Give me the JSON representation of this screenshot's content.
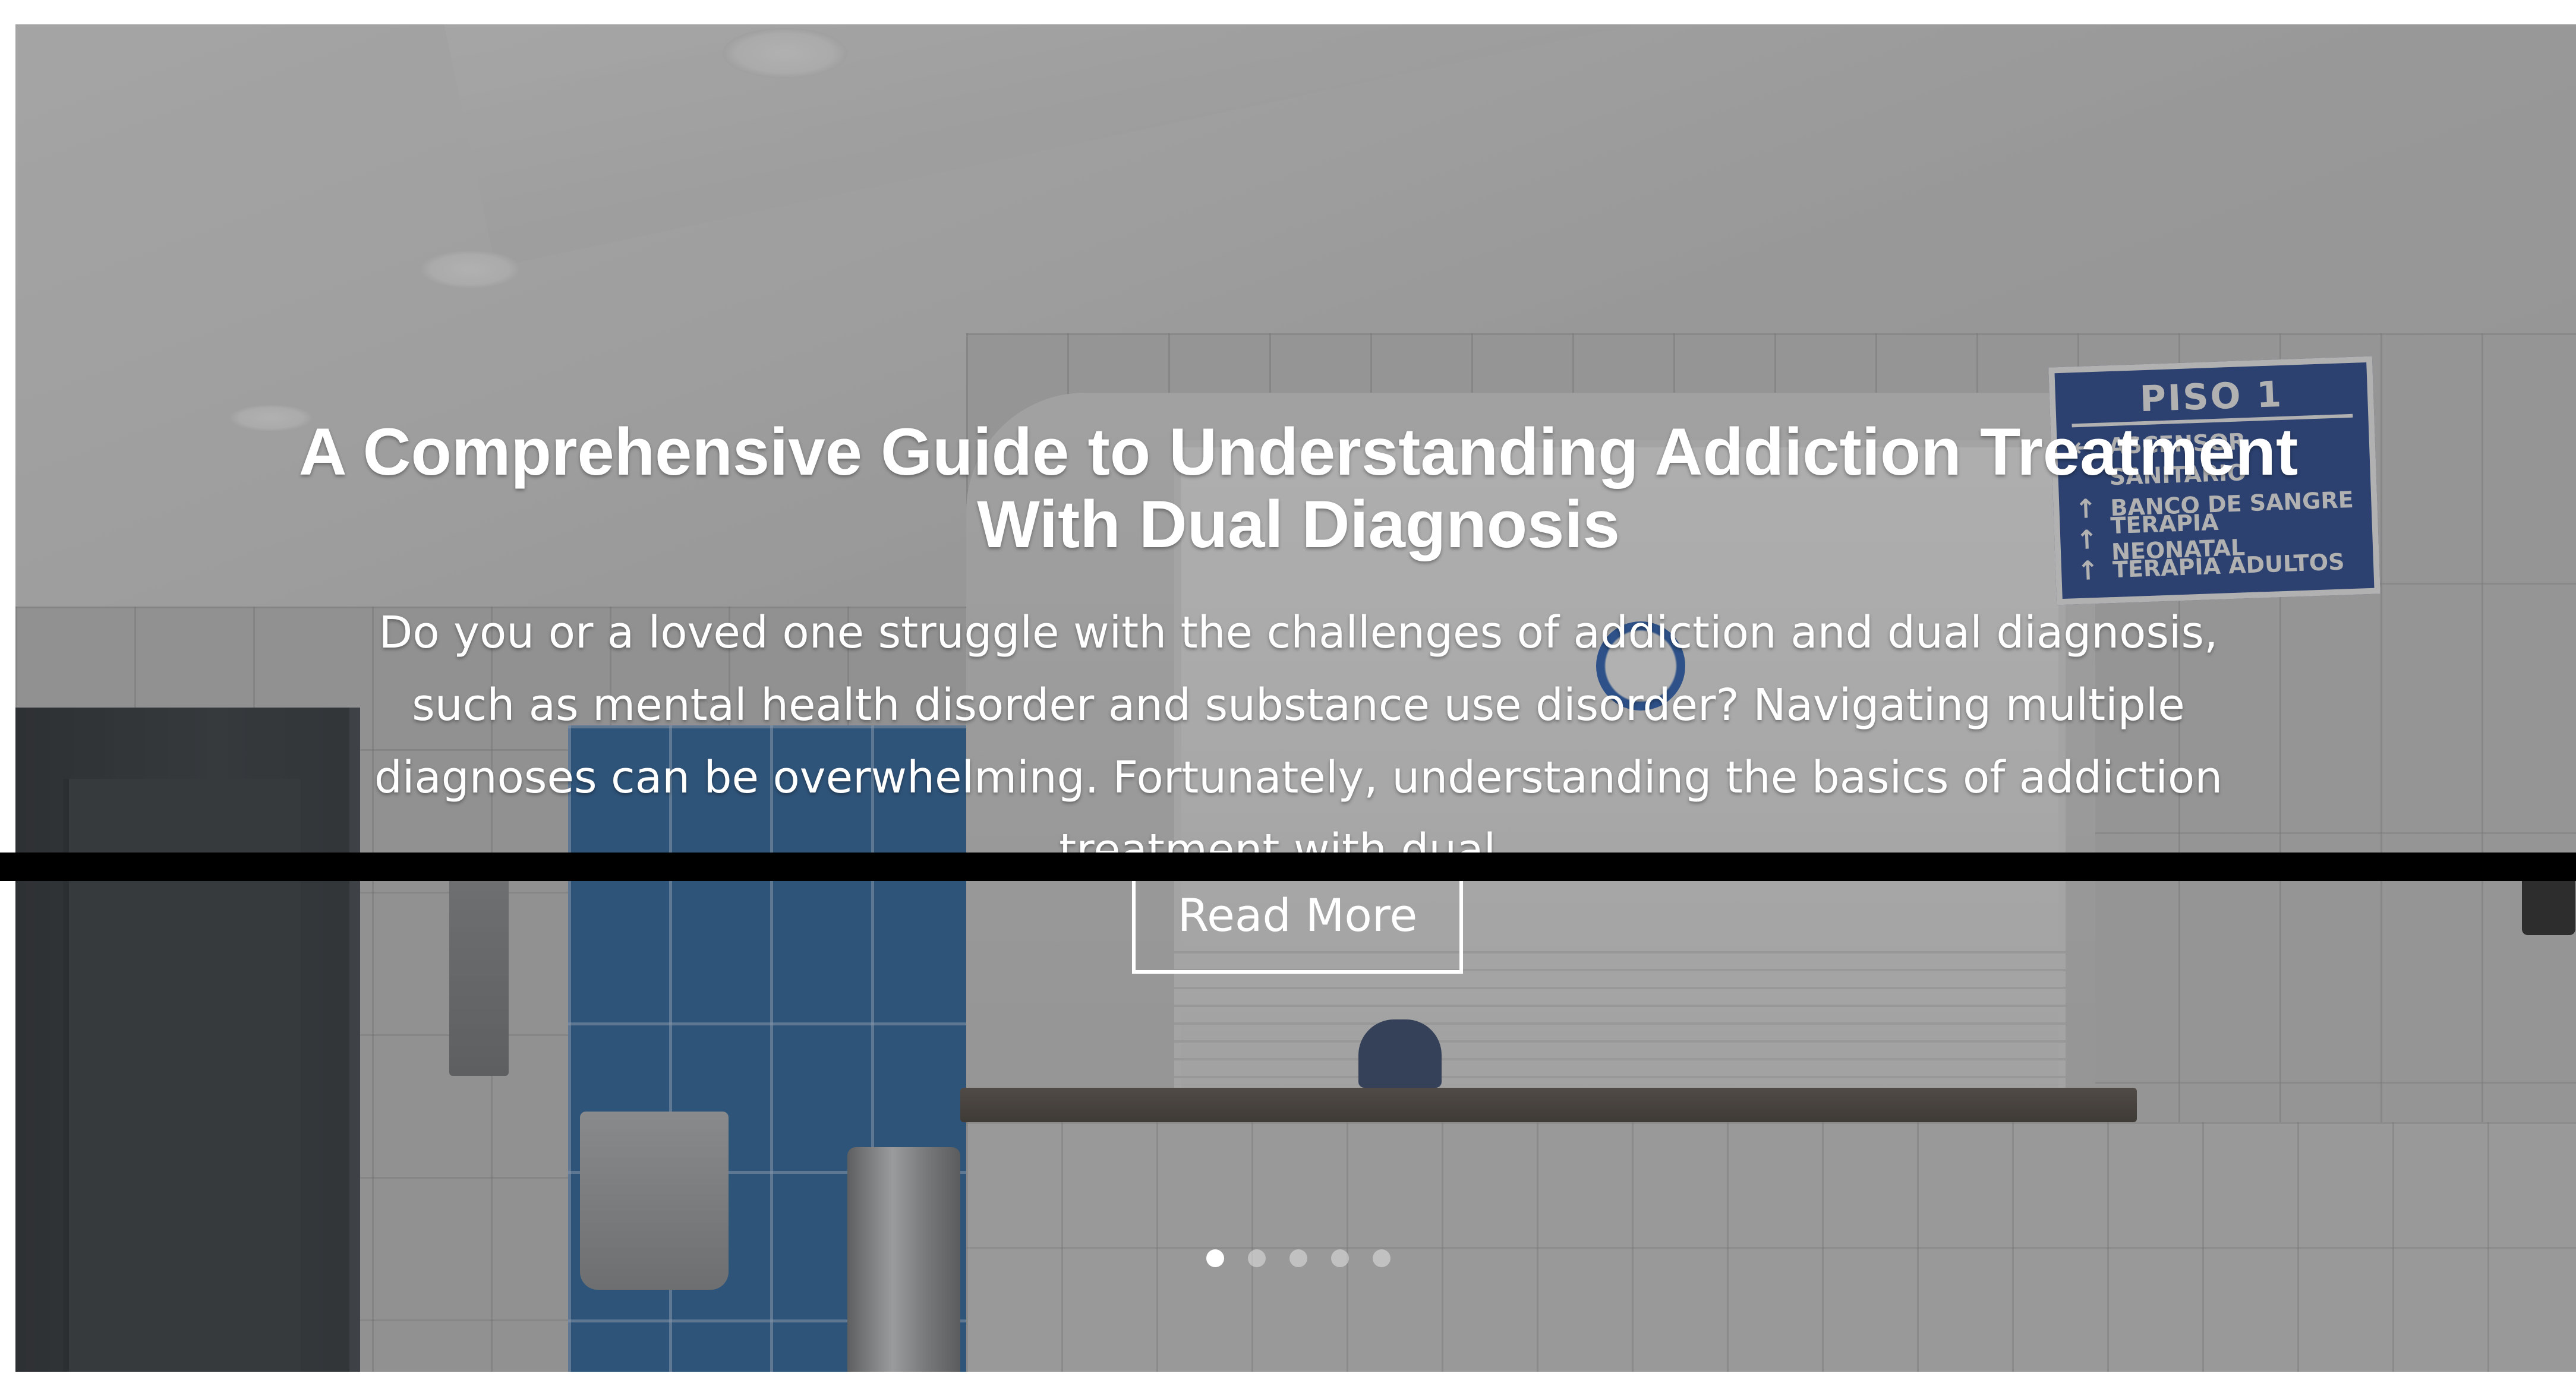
{
  "slide": {
    "title": "A Comprehensive Guide to Understanding Addiction Treatment With Dual Diagnosis",
    "description": "Do you or a loved one struggle with the challenges of addiction and dual diagnosis, such as mental health disorder and substance use disorder? Navigating multiple diagnoses can be overwhelming. Fortunately, understanding the basics of addiction treatment with dual...",
    "read_more_label": "Read More"
  },
  "background_sign": {
    "title": "PISO 1",
    "rows": [
      "ASCENSOR",
      "SANITARIO",
      "BANCO DE SANGRE",
      "TERAPIA NEONATAL",
      "TERAPIA ADULTOS"
    ]
  },
  "pagination": {
    "total": 5,
    "active_index": 0
  },
  "colors": {
    "overlay": "#464646",
    "text": "#ffffff",
    "sign_blue": "#1b3f8f",
    "band": "#000000"
  }
}
